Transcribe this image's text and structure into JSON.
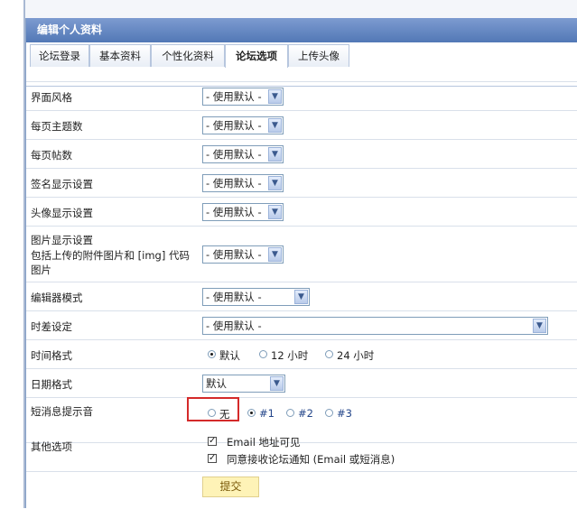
{
  "panel": {
    "title": "编辑个人资料"
  },
  "tabs": [
    {
      "label": "论坛登录"
    },
    {
      "label": "基本资料"
    },
    {
      "label": "个性化资料"
    },
    {
      "label": "论坛选项",
      "active": true
    },
    {
      "label": "上传头像"
    }
  ],
  "fields": {
    "style": {
      "label": "界面风格",
      "value": "- 使用默认 -"
    },
    "tpp": {
      "label": "每页主题数",
      "value": "- 使用默认 -"
    },
    "ppp": {
      "label": "每页帖数",
      "value": "- 使用默认 -"
    },
    "sig": {
      "label": "签名显示设置",
      "value": "- 使用默认 -"
    },
    "avatar": {
      "label": "头像显示设置",
      "value": "- 使用默认 -"
    },
    "image": {
      "label_line1": "图片显示设置",
      "label_line2": "包括上传的附件图片和 [img] 代码",
      "label_line3": "图片",
      "value": "- 使用默认 -"
    },
    "editor": {
      "label": "编辑器模式",
      "value": "- 使用默认 -"
    },
    "timezone": {
      "label": "时差设定",
      "value": "- 使用默认 -"
    },
    "timeformat": {
      "label": "时间格式",
      "options": [
        "默认",
        "12 小时",
        "24 小时"
      ],
      "selected": "默认"
    },
    "dateformat": {
      "label": "日期格式",
      "value": "默认"
    },
    "pmsound": {
      "label": "短消息提示音",
      "options": [
        "无",
        "#1",
        "#2",
        "#3"
      ],
      "selected": "#1"
    },
    "other": {
      "label": "其他选项",
      "checks": [
        {
          "label": "Email 地址可见",
          "checked": true
        },
        {
          "label": "同意接收论坛通知 (Email 或短消息)",
          "checked": true
        }
      ]
    }
  },
  "submit_label": "提交",
  "colors": {
    "header": "#5a7fbf",
    "highlight_box": "#d42a2a",
    "link": "#24468a",
    "submit_bg": "#fef3b7"
  }
}
